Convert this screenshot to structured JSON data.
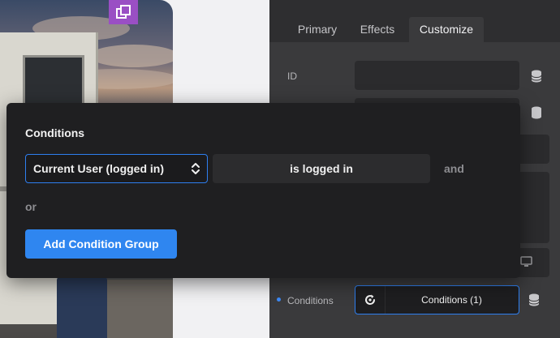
{
  "tabs": [
    {
      "label": "Primary",
      "active": false
    },
    {
      "label": "Effects",
      "active": false
    },
    {
      "label": "Customize",
      "active": true
    }
  ],
  "fields": {
    "id_label": "ID",
    "conditions_label": "Conditions",
    "conditions_button": "Conditions (1)"
  },
  "popup": {
    "title": "Conditions",
    "subject_select": "Current User (logged in)",
    "operator": "is logged in",
    "and_label": "and",
    "or_label": "or",
    "add_group_button": "Add Condition Group"
  },
  "colors": {
    "accent": "#2f86f0",
    "badge": "#9a4fc4",
    "panel_bg": "#3a3a3c",
    "popup_bg": "#1f1f21"
  },
  "icons": {
    "badge": "copy-layers-icon",
    "database": "database-icon",
    "desktop": "desktop-icon",
    "conditions": "conditions-refresh-icon",
    "select": "chevron-updown-icon"
  }
}
